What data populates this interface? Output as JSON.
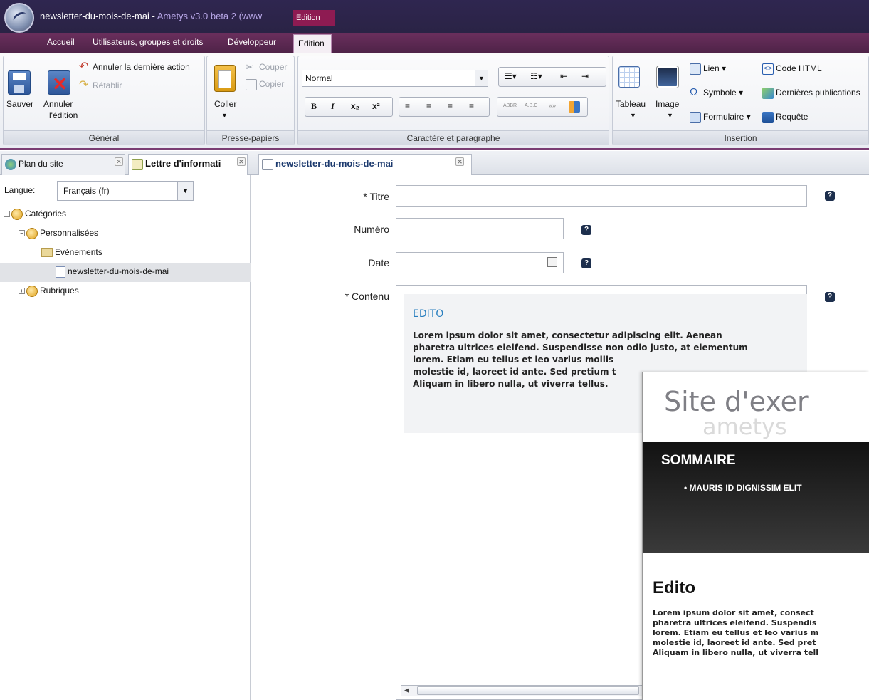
{
  "window": {
    "title_doc": "newsletter-du-mois-de-mai - ",
    "title_app": "Ametys v3.0 beta 2 (www",
    "context_tab": "Edition"
  },
  "tabs": [
    {
      "label": "Accueil"
    },
    {
      "label": "Utilisateurs, groupes et droits"
    },
    {
      "label": "Développeur"
    },
    {
      "label": "Edition"
    }
  ],
  "ribbon": {
    "general": {
      "title": "Général",
      "save": "Sauver",
      "cancel_1": "Annuler",
      "cancel_2": "l'édition",
      "undo": "Annuler la dernière action",
      "redo": "Rétablir"
    },
    "clipboard": {
      "title": "Presse-papiers",
      "paste": "Coller",
      "cut": "Couper",
      "copy": "Copier"
    },
    "format": {
      "title": "Caractère et paragraphe",
      "style_value": "Normal",
      "bold": "B",
      "italic": "I",
      "sub": "x₂",
      "sup": "x²",
      "abbr": "ABBR",
      "acronym": "A.B.C",
      "quote": "«»"
    },
    "insertion": {
      "title": "Insertion",
      "table": "Tableau",
      "image": "Image",
      "link": "Lien ▾",
      "symbol": "Symbole ▾",
      "form": "Formulaire ▾",
      "html": "Code HTML",
      "latest": "Dernières publications",
      "query": "Requête"
    }
  },
  "left_panel": {
    "tab_sitemap": "Plan du site",
    "tab_newsletter": "Lettre d'informati",
    "lang_label": "Langue:",
    "lang_value": "Français (fr)",
    "tree": [
      {
        "label": "Catégories"
      },
      {
        "label": "Personnalisées"
      },
      {
        "label": "Evénements"
      },
      {
        "label": "newsletter-du-mois-de-mai"
      },
      {
        "label": "Rubriques"
      }
    ]
  },
  "editor": {
    "tab": "newsletter-du-mois-de-mai",
    "fields": {
      "title_label": "* Titre",
      "number_label": "Numéro",
      "date_label": "Date",
      "content_label": "* Contenu",
      "help": "?"
    },
    "content": {
      "heading": "EDITO",
      "line1": "Lorem ipsum dolor sit amet, consectetur adipiscing elit. Aenean",
      "line2": "pharetra ultrices eleifend. Suspendisse non odio justo, at elementum",
      "line3": "lorem. Etiam eu tellus et leo varius mollis",
      "line4": "molestie id, laoreet id ante. Sed pretium t",
      "line5": "Aliquam in libero nulla, ut viverra tellus."
    }
  },
  "preview": {
    "site_title": "Site d'exer",
    "brand": "ametys",
    "summary_title": "SOMMAIRE",
    "summary_item": "MAURIS ID DIGNISSIM ELIT",
    "edito_title": "Edito",
    "line1": "Lorem ipsum dolor sit amet, consect",
    "line2": "pharetra ultrices eleifend. Suspendis",
    "line3": "lorem. Etiam eu tellus et leo varius m",
    "line4": "molestie id, laoreet id ante. Sed pret",
    "line5": "Aliquam in libero nulla, ut viverra tell"
  }
}
